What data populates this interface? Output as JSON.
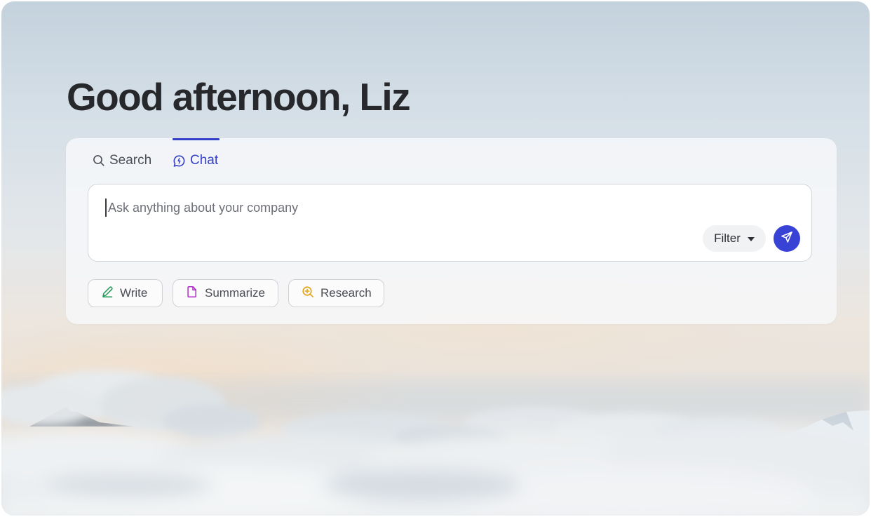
{
  "greeting": "Good afternoon, Liz",
  "tabs": [
    {
      "label": "Search",
      "icon": "search-icon",
      "active": false
    },
    {
      "label": "Chat",
      "icon": "chat-icon",
      "active": true
    }
  ],
  "composer": {
    "placeholder": "Ask anything about your company",
    "value": "",
    "filter_label": "Filter",
    "send_icon": "send-icon"
  },
  "quick_actions": [
    {
      "label": "Write",
      "icon": "pencil-icon",
      "color": "#1f9a57"
    },
    {
      "label": "Summarize",
      "icon": "document-icon",
      "color": "#b02bc8"
    },
    {
      "label": "Research",
      "icon": "magnify-plus-icon",
      "color": "#e0a411"
    }
  ],
  "colors": {
    "accent": "#3440c7",
    "send_button": "#3843d6",
    "heading": "#26282c"
  }
}
